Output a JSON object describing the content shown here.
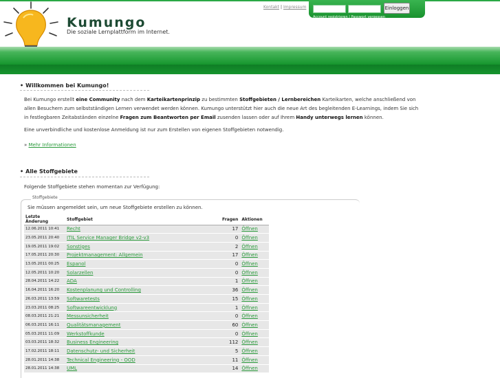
{
  "header": {
    "brand": "Kumungo",
    "tagline": "Die soziale Lernplattform im Internet.",
    "link_kontakt": "Kontakt",
    "link_sep": "|",
    "link_impressum": "Impressum",
    "login_button": "Einloggen",
    "login_links": "Account registrieren | Passwort vergessen"
  },
  "welcome": {
    "title": "Willkommen bei Kumungo!",
    "p1_a": "Bei Kumungo erstellt ",
    "p1_b": "eine Community",
    "p1_c": " nach dem ",
    "p1_d": "Karteikartenprinzip",
    "p1_e": " zu bestimmten ",
    "p1_f": "Stoffgebieten / Lernbereichen",
    "p1_g": " Karteikarten, welche anschließend von allen Besuchern zum selbstständigen Lernen verwendet werden können. Kumungo unterstützt hier auch die neue Art des begleitenden E-Learnings, indem Sie sich in festlegbaren Zeitabständen einzelne ",
    "p1_h": "Fragen zum Beantworten per Email",
    "p1_i": " zusenden lassen oder auf Ihrem ",
    "p1_j": "Handy unterwegs lernen",
    "p1_k": " können.",
    "p2": "Eine unverbindliche und kostenlose Anmeldung ist nur zum Erstellen von eigenen Stoffgebieten notwendig.",
    "more_prefix": "» ",
    "more_link": "Mehr Informationen"
  },
  "subjects": {
    "title": "Alle Stoffgebiete",
    "intro": "Folgende Stoffgebiete stehen momentan zur Verfügung:",
    "legend": "Stoffgebiete",
    "note": "Sie müssen angemeldet sein, um neue Stoffgebiete erstellen zu können.",
    "columns": [
      "Letzte Änderung",
      "Stoffgebiet",
      "Fragen",
      "Aktionen"
    ],
    "rows": [
      {
        "date": "12.06.2011 10:41",
        "name": "Recht",
        "count": "17",
        "action": "Öffnen"
      },
      {
        "date": "23.05.2011 20:40",
        "name": "ITIL Service Manager Bridge v2-v3",
        "count": "0",
        "action": "Öffnen"
      },
      {
        "date": "19.05.2011 19:02",
        "name": "Sonstiges",
        "count": "2",
        "action": "Öffnen"
      },
      {
        "date": "17.05.2011 20:30",
        "name": "Projektmanagement: Allgemein",
        "count": "17",
        "action": "Öffnen"
      },
      {
        "date": "13.05.2011 00:25",
        "name": "Espanol",
        "count": "0",
        "action": "Öffnen"
      },
      {
        "date": "12.05.2011 10:20",
        "name": "Solarzellen",
        "count": "0",
        "action": "Öffnen"
      },
      {
        "date": "28.04.2011 14:22",
        "name": "ADA",
        "count": "1",
        "action": "Öffnen"
      },
      {
        "date": "16.04.2011 16:20",
        "name": "Kostenplanung und Controlling",
        "count": "36",
        "action": "Öffnen"
      },
      {
        "date": "26.03.2011 13:59",
        "name": "Softwaretests",
        "count": "15",
        "action": "Öffnen"
      },
      {
        "date": "23.03.2011 08:25",
        "name": "Softwareentwicklung",
        "count": "1",
        "action": "Öffnen"
      },
      {
        "date": "08.03.2011 21:21",
        "name": "Messunsicherheit",
        "count": "0",
        "action": "Öffnen"
      },
      {
        "date": "06.03.2011 16:11",
        "name": "Qualitätsmanagement",
        "count": "60",
        "action": "Öffnen"
      },
      {
        "date": "05.03.2011 11:09",
        "name": "Werkstoffkunde",
        "count": "0",
        "action": "Öffnen"
      },
      {
        "date": "03.03.2011 18:32",
        "name": "Business Engineering",
        "count": "112",
        "action": "Öffnen"
      },
      {
        "date": "17.02.2011 18:11",
        "name": "Datenschutz- und Sicherheit",
        "count": "5",
        "action": "Öffnen"
      },
      {
        "date": "28.01.2011 14:38",
        "name": "Technical Engineering - OOD",
        "count": "11",
        "action": "Öffnen"
      },
      {
        "date": "28.01.2011 14:38",
        "name": "UML",
        "count": "14",
        "action": "Öffnen"
      }
    ]
  },
  "colors": {
    "brand_green": "#1a9a33",
    "link_green": "#2a9a3b"
  },
  "icons": [
    "lightbulb-logo-icon"
  ]
}
